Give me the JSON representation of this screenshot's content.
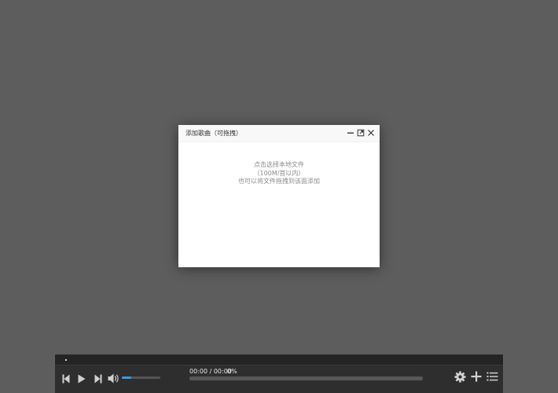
{
  "dialog": {
    "title": "添加歌曲（可拖拽）",
    "hint_line1": "点击选择本地文件",
    "hint_line2": "（100M/首以内）",
    "hint_line3": "也可以将文件拖拽到该面添加",
    "controls": [
      "minimize-icon",
      "maximize-icon",
      "close-icon"
    ]
  },
  "player": {
    "current_time": "00:00",
    "separator": "/",
    "total_time": "00:00",
    "time_display": "00:00 / 00:00",
    "progress_label": "0%",
    "progress": 0,
    "volume": 0.25,
    "icons": [
      "previous-icon",
      "play-icon",
      "next-icon",
      "volume-icon",
      "settings-icon",
      "add-icon",
      "playlist-icon"
    ]
  },
  "colors": {
    "backdrop": "#5d5d5d",
    "player_bg": "#2e2e2e",
    "accent": "#2e9ee6",
    "hint_text": "#8c8c8c"
  }
}
